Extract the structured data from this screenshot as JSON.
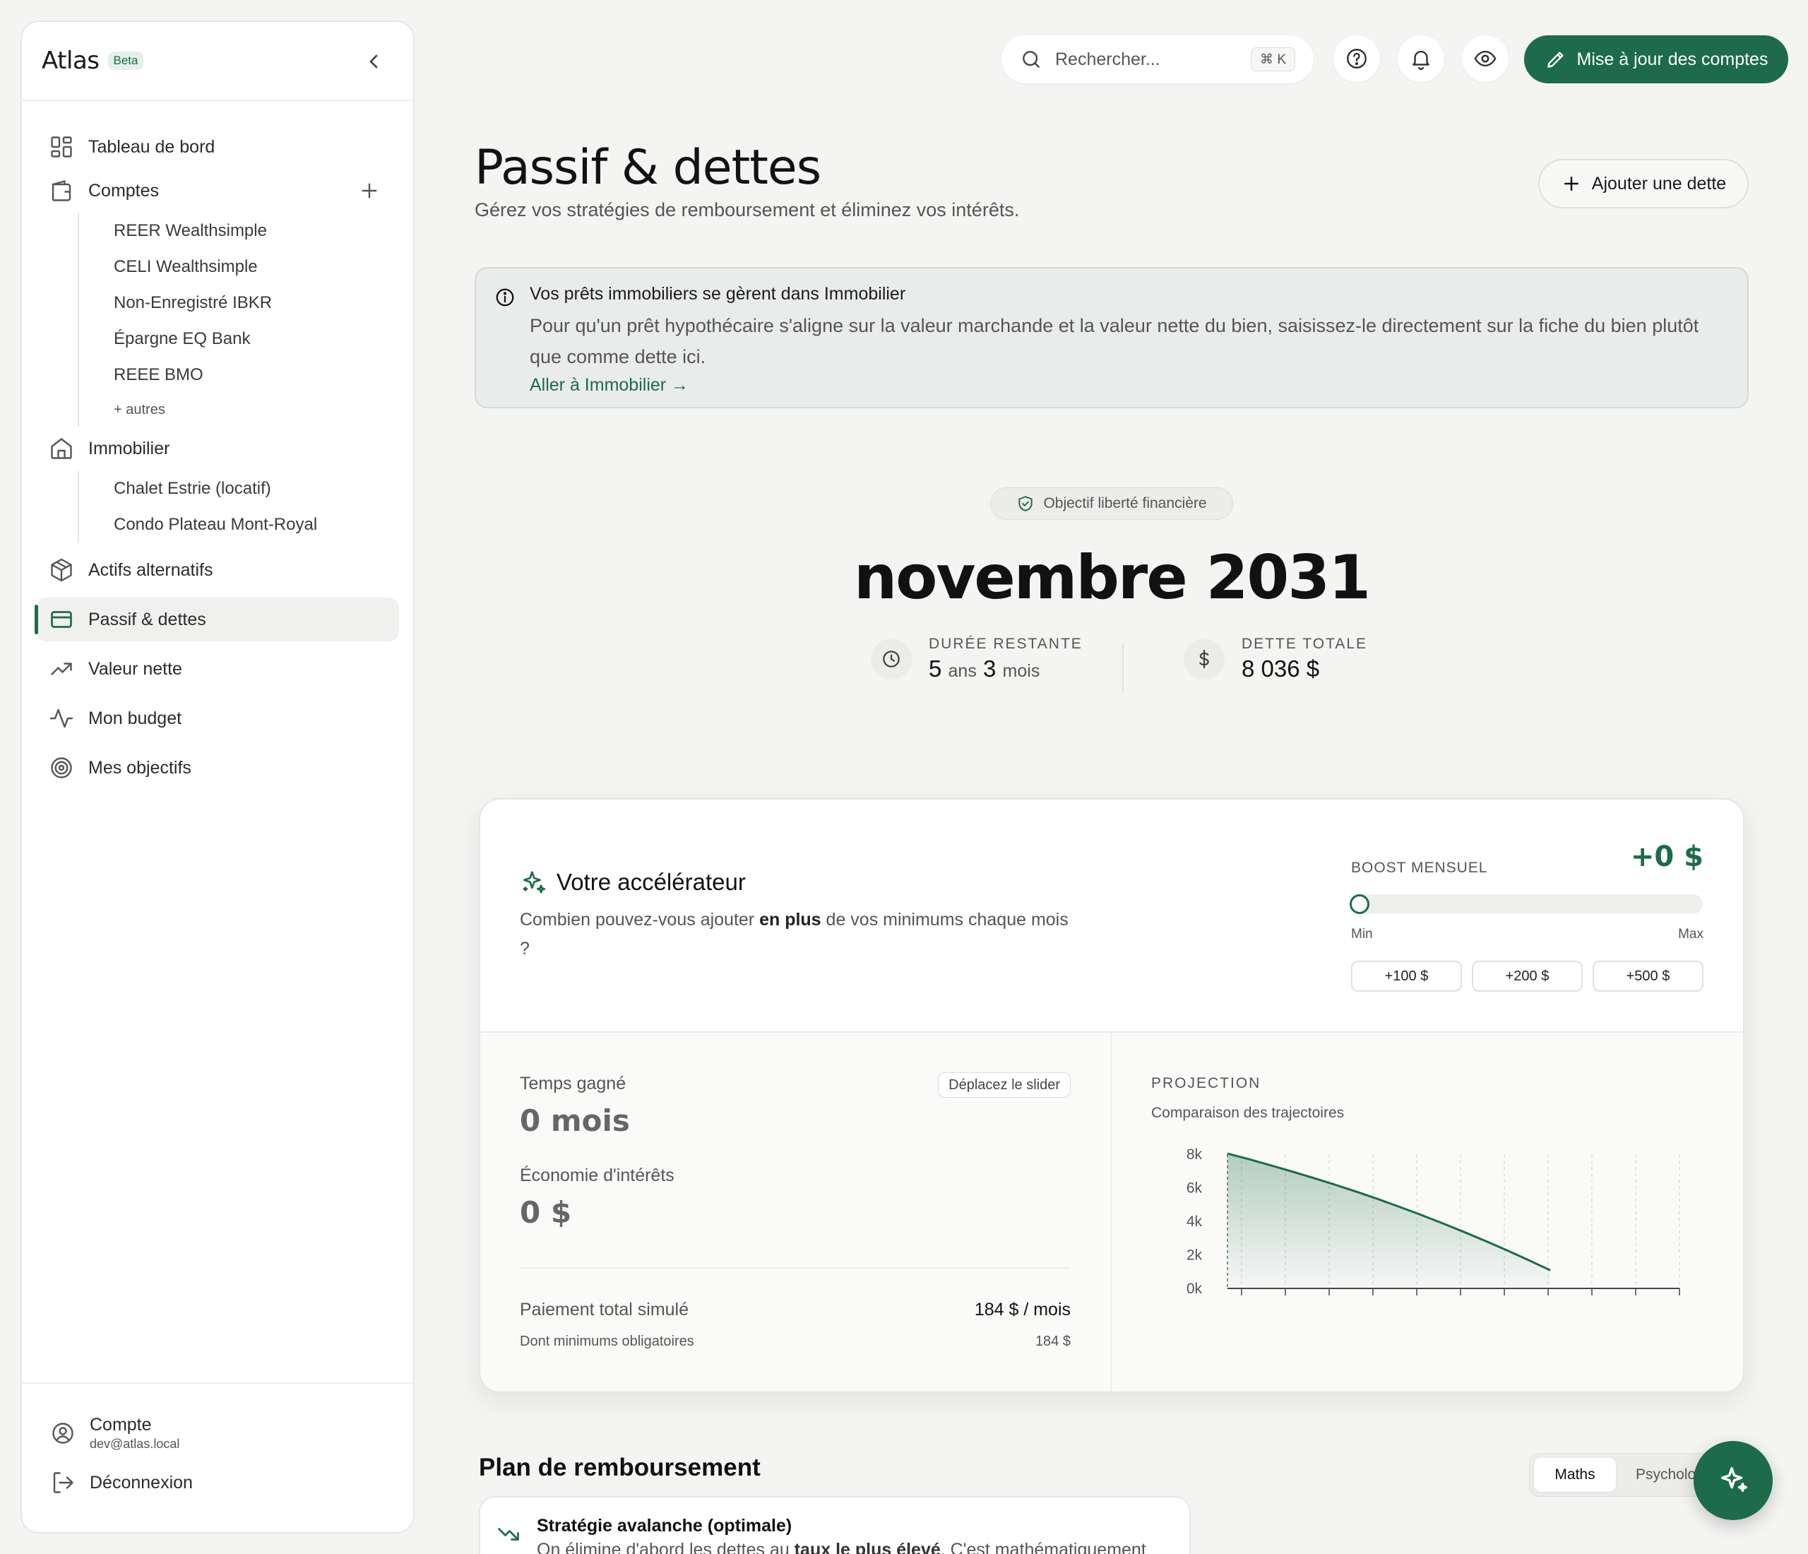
{
  "brand": {
    "name": "Atlas",
    "badge": "Beta"
  },
  "sidebar": {
    "items": [
      {
        "label": "Tableau de bord",
        "icon": "dashboard-icon"
      },
      {
        "label": "Comptes",
        "icon": "wallet-icon",
        "subs": [
          "REER Wealthsimple",
          "CELI Wealthsimple",
          "Non-Enregistré IBKR",
          "Épargne EQ Bank",
          "REEE BMO"
        ],
        "more": "+ autres"
      },
      {
        "label": "Immobilier",
        "icon": "home-icon",
        "subs": [
          "Chalet Estrie (locatif)",
          "Condo Plateau Mont-Royal"
        ]
      },
      {
        "label": "Actifs alternatifs",
        "icon": "package-icon"
      },
      {
        "label": "Passif & dettes",
        "icon": "credit-card-icon",
        "active": true
      },
      {
        "label": "Valeur nette",
        "icon": "trending-up-icon"
      },
      {
        "label": "Mon budget",
        "icon": "activity-icon"
      },
      {
        "label": "Mes objectifs",
        "icon": "target-icon"
      }
    ],
    "account": {
      "label": "Compte",
      "email": "dev@atlas.local"
    },
    "logout": "Déconnexion"
  },
  "topbar": {
    "search_placeholder": "Rechercher...",
    "shortcut": "⌘ K",
    "update_button": "Mise à jour des comptes"
  },
  "header": {
    "title": "Passif & dettes",
    "subtitle": "Gérez vos stratégies de remboursement et éliminez vos intérêts.",
    "add_button": "Ajouter une dette"
  },
  "banner": {
    "title": "Vos prêts immobiliers se gèrent dans Immobilier",
    "text": "Pour qu'un prêt hypothécaire s'aligne sur la valeur marchande et la valeur nette du bien, saisissez-le directement sur la fiche du bien plutôt que comme dette ici.",
    "link": "Aller à Immobilier →"
  },
  "hero": {
    "pill": "Objectif liberté financière",
    "date": "novembre 2031",
    "duration_label": "DURÉE RESTANTE",
    "duration_years": "5",
    "duration_years_unit": "ans",
    "duration_months": "3",
    "duration_months_unit": "mois",
    "debt_label": "DETTE TOTALE",
    "debt_value": "8 036 $"
  },
  "accelerator": {
    "title": "Votre accélérateur",
    "desc_before": "Combien pouvez-vous ajouter ",
    "desc_bold": "en plus",
    "desc_after": " de vos minimums chaque mois ?",
    "boost_label": "BOOST MENSUEL",
    "boost_value": "+0 $",
    "slider_value": 0,
    "min_label": "Min",
    "max_label": "Max",
    "chips": [
      "+100 $",
      "+200 $",
      "+500 $"
    ],
    "time_label": "Temps gagné",
    "time_value": "0 mois",
    "hint": "Déplacez le slider",
    "interest_label": "Économie d'intérêts",
    "interest_value": "0 $",
    "total_label": "Paiement total simulé",
    "total_value": "184 $ / mois",
    "min_pay_label": "Dont minimums obligatoires",
    "min_pay_value": "184 $"
  },
  "projection": {
    "label": "PROJECTION",
    "subtitle": "Comparaison des trajectoires"
  },
  "chart_data": {
    "type": "area",
    "y_ticks": [
      "8k",
      "6k",
      "4k",
      "2k",
      "0k"
    ],
    "ylim": [
      0,
      8000
    ],
    "x": [
      0,
      6,
      12,
      18,
      24,
      30,
      36,
      42,
      48,
      54,
      60,
      66,
      72,
      78,
      84,
      90
    ],
    "values": [
      8036,
      7700,
      7340,
      6970,
      6580,
      6180,
      5760,
      5320,
      4860,
      4380,
      3880,
      3360,
      2820,
      2260,
      1680,
      1080
    ],
    "xlim": [
      0,
      126
    ],
    "color": "#1d6b4a",
    "grid": "vertical dashed"
  },
  "plan": {
    "title": "Plan de remboursement",
    "tabs": [
      "Maths",
      "Psychologie"
    ],
    "strategy_title": "Stratégie avalanche (optimale)",
    "strategy_before": "On élimine d'abord les dettes au ",
    "strategy_bold": "taux le plus élevé",
    "strategy_after": ". C'est mathématiquement"
  },
  "colors": {
    "accent": "#1d6b4a",
    "background": "#f4f4f3"
  }
}
